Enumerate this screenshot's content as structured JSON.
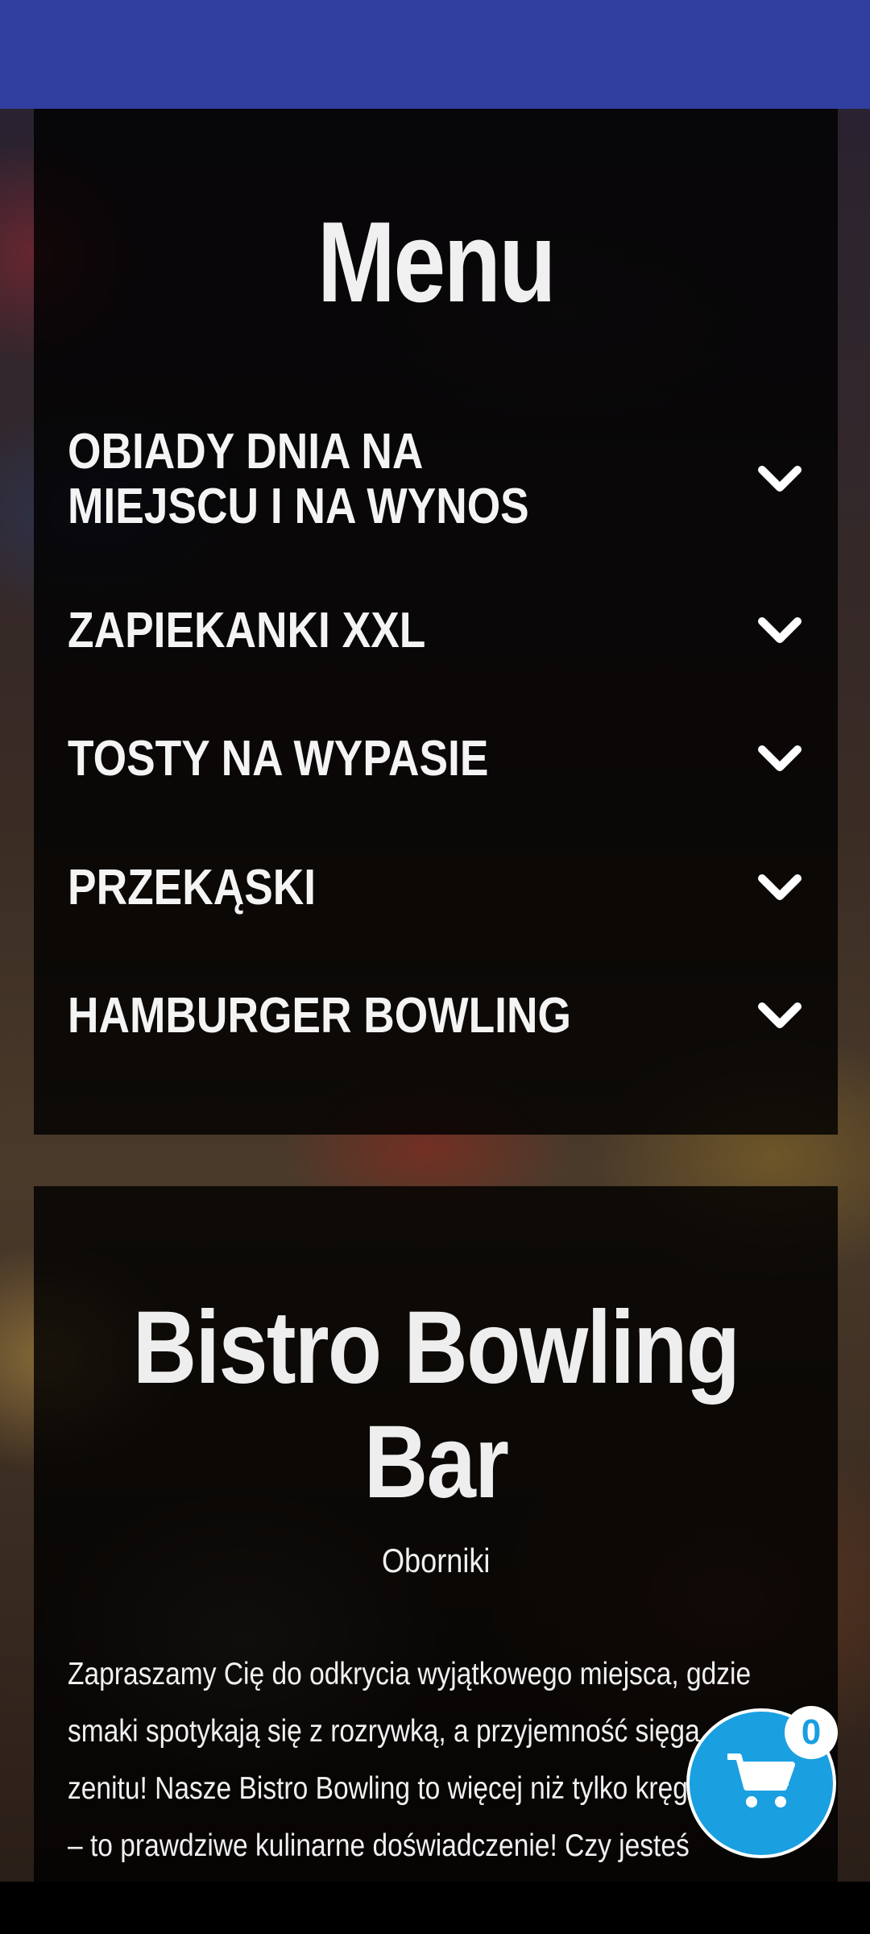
{
  "menu": {
    "title": "Menu",
    "categories": [
      {
        "label": "OBIADY DNIA NA MIEJSCU I NA WYNOS"
      },
      {
        "label": "ZAPIEKANKI XXL"
      },
      {
        "label": "TOSTY NA WYPASIE"
      },
      {
        "label": "PRZEKĄSKI"
      },
      {
        "label": "HAMBURGER BOWLING"
      }
    ]
  },
  "restaurant": {
    "name": "Bistro Bowling Bar",
    "city": "Oborniki",
    "description": "Zapraszamy Cię do odkrycia wyjątkowego miejsca, gdzie smaki spotykają się z rozrywką, a przyjemność sięga zenitu! Nasze Bistro Bowling to więcej niż tylko kręgielnia – to prawdziwe kulinarne doświadczenie! Czy jesteś miłośnikiem"
  },
  "cart": {
    "count": "0",
    "icon": "cart-icon"
  },
  "colors": {
    "topbar": "#303f9f",
    "cart_button": "#1a9fe0",
    "panel": "rgba(0,0,0,0.82)"
  }
}
